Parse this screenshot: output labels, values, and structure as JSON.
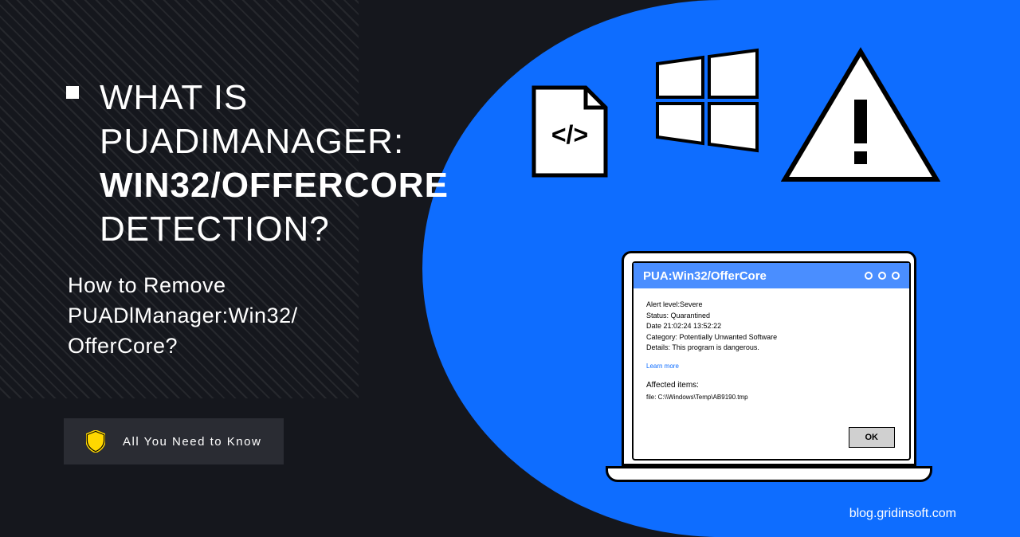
{
  "heading": {
    "line1": "WHAT IS",
    "line2": "PUADIMANAGER:",
    "line3_bold": "WIN32/OFFERCORE",
    "line4": "DETECTION?"
  },
  "subtitle": {
    "line1": "How to Remove",
    "line2": "PUADlManager:Win32/",
    "line3": "OfferCore?"
  },
  "badge": {
    "text": "All You Need to Know"
  },
  "dialog": {
    "title": "PUA:Win32/OfferCore",
    "alert_level": "Alert level:Severe",
    "status": "Status: Quarantined",
    "date": "Date 21:02:24 13:52:22",
    "category": "Category: Potentially Unwanted Software",
    "details": "Details: This program is dangerous.",
    "learn_more": "Learn more",
    "affected_label": "Affected items:",
    "affected_file": "file: C:\\\\Windows\\Temp\\AB9190.tmp",
    "ok_button": "OK"
  },
  "footer": {
    "url": "blog.gridinsoft.com"
  }
}
